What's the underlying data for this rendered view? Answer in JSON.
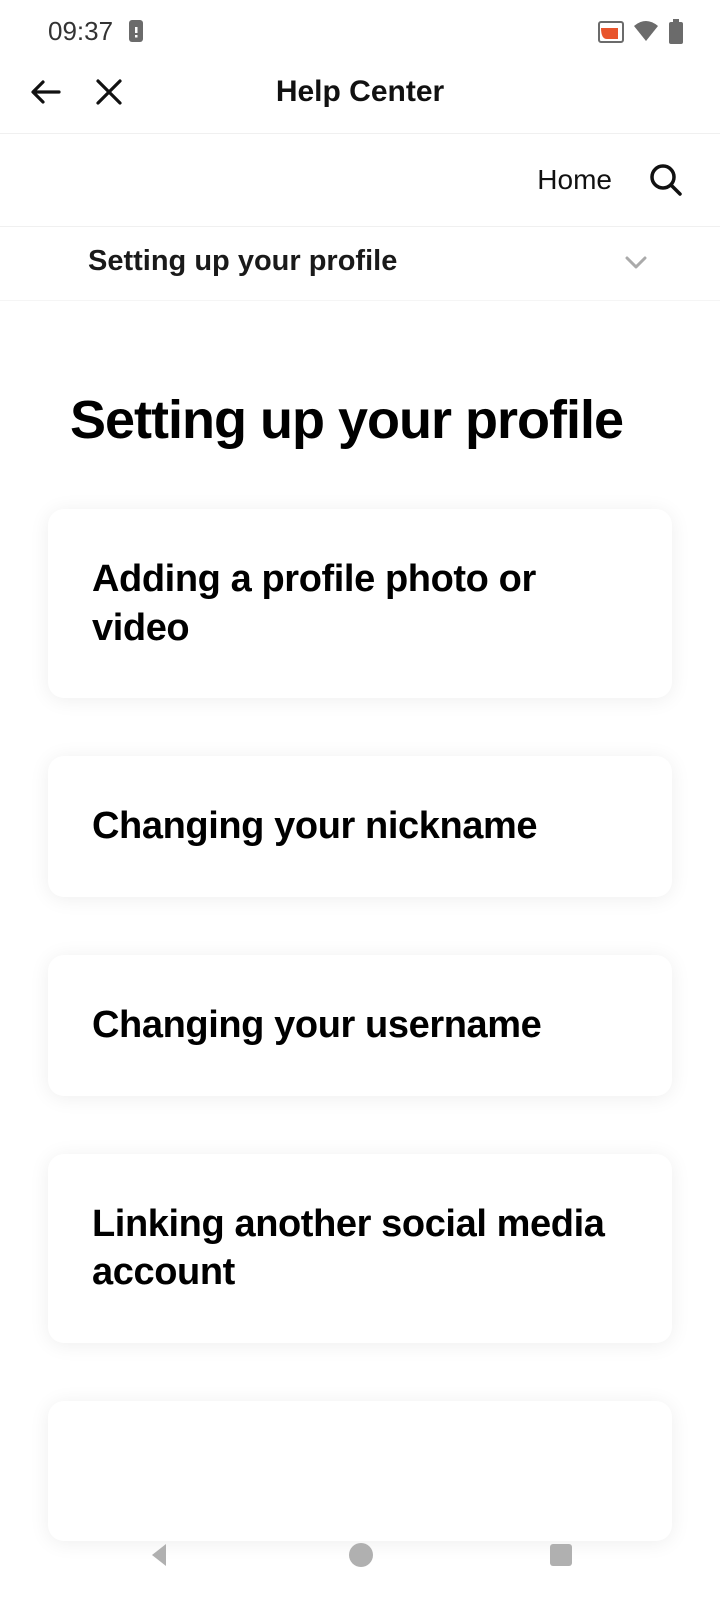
{
  "status": {
    "time": "09:37"
  },
  "appBar": {
    "title": "Help Center"
  },
  "secondaryBar": {
    "home": "Home"
  },
  "breadcrumb": {
    "label": "Setting up your profile"
  },
  "page": {
    "title": "Setting up your profile"
  },
  "cards": [
    "Adding a profile photo or video",
    "Changing your nickname",
    "Changing your username",
    "Linking another social media account"
  ]
}
